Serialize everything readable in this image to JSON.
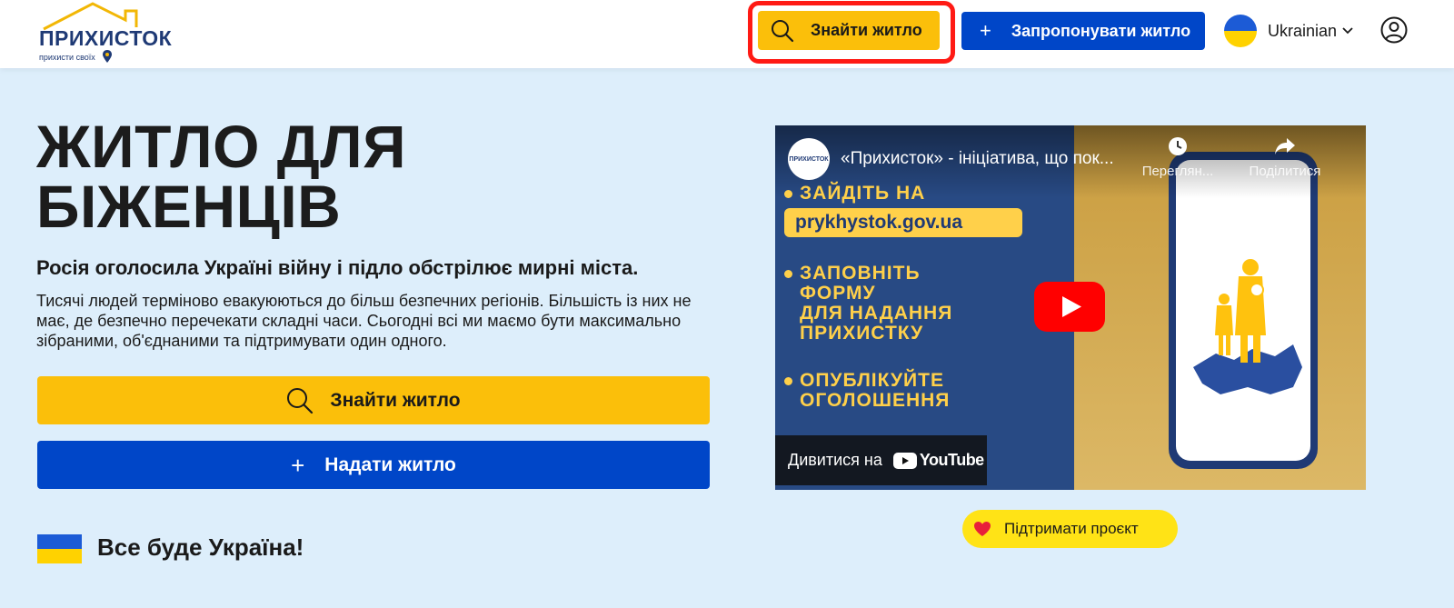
{
  "header": {
    "logo": {
      "title": "ПРИХИСТОК",
      "subtitle": "прихисти своїх"
    },
    "find_label": "Знайти житло",
    "offer_label": "Запропонувати житло",
    "language": "Ukrainian"
  },
  "hero": {
    "title_line1": "ЖИТЛО ДЛЯ",
    "title_line2": "БІЖЕНЦІВ",
    "subtitle": "Росія оголосила Україні війну і підло обстрілює мирні міста.",
    "text": "Тисячі людей терміново евакуюються до більш безпечних регіонів. Більшість із них не має, де безпечно перечекати складні часи. Сьогодні всі ми маємо бути максимально зібраними, об'єднаними та підтримувати один одного.",
    "find_button": "Знайти житло",
    "give_button": "Надати житло",
    "slogan": "Все буде Україна!"
  },
  "video": {
    "title": "«Прихисток» - ініціатива, що пок...",
    "watch_later": "Переглян...",
    "share": "Поділитися",
    "step1": "ЗАЙДІТЬ НА",
    "url": "prykhystok.gov.ua",
    "step2_line1": "ЗАПОВНІТЬ",
    "step2_line2": "ФОРМУ",
    "step2_line3": "ДЛЯ НАДАННЯ",
    "step2_line4": "ПРИХИСТКУ",
    "step3_line1": "ОПУБЛІКУЙТЕ",
    "step3_line2": "ОГОЛОШЕННЯ",
    "watch_on": "Дивитися на",
    "youtube": "YouTube",
    "channel_avatar_text": "ПРИХИСТОК"
  },
  "support_label": "Підтримати проєкт",
  "colors": {
    "yellow": "#fbbf0a",
    "blue": "#0046c8",
    "background": "#ddeefb",
    "highlight": "#ff1a14"
  }
}
